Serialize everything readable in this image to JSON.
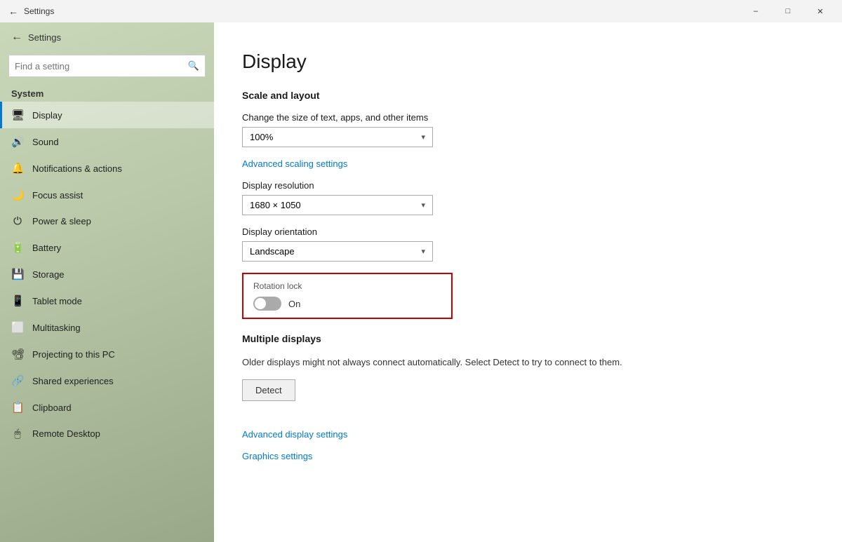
{
  "titlebar": {
    "title": "Settings",
    "back_icon": "←",
    "minimize": "–",
    "maximize": "□",
    "close": "✕"
  },
  "sidebar": {
    "search_placeholder": "Find a setting",
    "section": "System",
    "items": [
      {
        "id": "display",
        "label": "Display",
        "icon": "🖥",
        "active": true
      },
      {
        "id": "sound",
        "label": "Sound",
        "icon": "🔊",
        "active": false
      },
      {
        "id": "notifications",
        "label": "Notifications & actions",
        "icon": "🔔",
        "active": false
      },
      {
        "id": "focus",
        "label": "Focus assist",
        "icon": "🌙",
        "active": false
      },
      {
        "id": "power",
        "label": "Power & sleep",
        "icon": "⏻",
        "active": false
      },
      {
        "id": "battery",
        "label": "Battery",
        "icon": "🔋",
        "active": false
      },
      {
        "id": "storage",
        "label": "Storage",
        "icon": "💾",
        "active": false
      },
      {
        "id": "tablet",
        "label": "Tablet mode",
        "icon": "📱",
        "active": false
      },
      {
        "id": "multitasking",
        "label": "Multitasking",
        "icon": "⬜",
        "active": false
      },
      {
        "id": "projecting",
        "label": "Projecting to this PC",
        "icon": "📽",
        "active": false
      },
      {
        "id": "shared",
        "label": "Shared experiences",
        "icon": "🔗",
        "active": false
      },
      {
        "id": "clipboard",
        "label": "Clipboard",
        "icon": "📋",
        "active": false
      },
      {
        "id": "remote",
        "label": "Remote Desktop",
        "icon": "🖱",
        "active": false
      }
    ]
  },
  "main": {
    "page_title": "Display",
    "scale_section": "Scale and layout",
    "scale_label": "Change the size of text, apps, and other items",
    "scale_value": "100%",
    "advanced_scaling_link": "Advanced scaling settings",
    "resolution_label": "Display resolution",
    "resolution_value": "1680 × 1050",
    "orientation_label": "Display orientation",
    "orientation_value": "Landscape",
    "rotation_lock_label": "Rotation lock",
    "rotation_lock_state": "On",
    "multiple_displays_section": "Multiple displays",
    "multiple_displays_desc": "Older displays might not always connect automatically. Select Detect to try to connect to them.",
    "detect_btn": "Detect",
    "advanced_display_link": "Advanced display settings",
    "graphics_link": "Graphics settings"
  }
}
